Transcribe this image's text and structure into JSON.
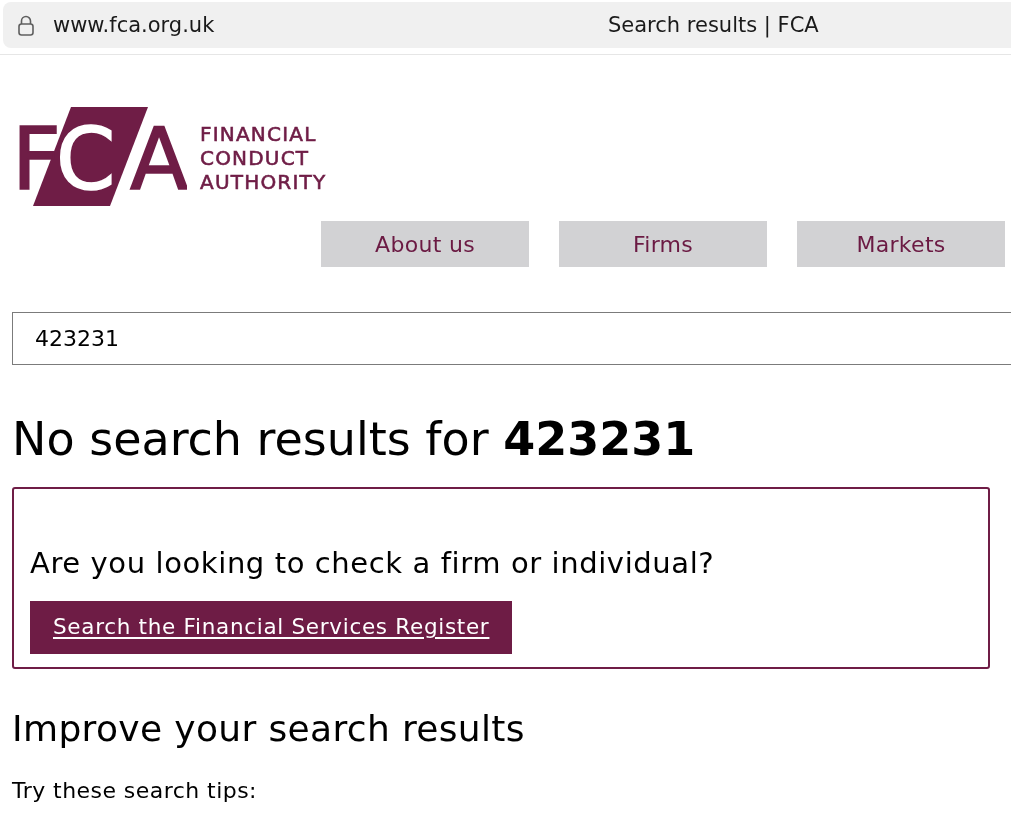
{
  "browser": {
    "url": "www.fca.org.uk",
    "title": "Search results | FCA"
  },
  "logo": {
    "letters": [
      "F",
      "C",
      "A"
    ],
    "wordmark": [
      "FINANCIAL",
      "CONDUCT",
      "AUTHORITY"
    ]
  },
  "nav": [
    "About us",
    "Firms",
    "Markets"
  ],
  "search": {
    "value": "423231"
  },
  "heading": "No search results for **423231**",
  "register_box": {
    "question": "Are you looking to check a firm or individual?",
    "button": "Search the Financial Services Register"
  },
  "tips": {
    "heading": "Improve your search results",
    "intro": "Try these search tips:"
  }
}
